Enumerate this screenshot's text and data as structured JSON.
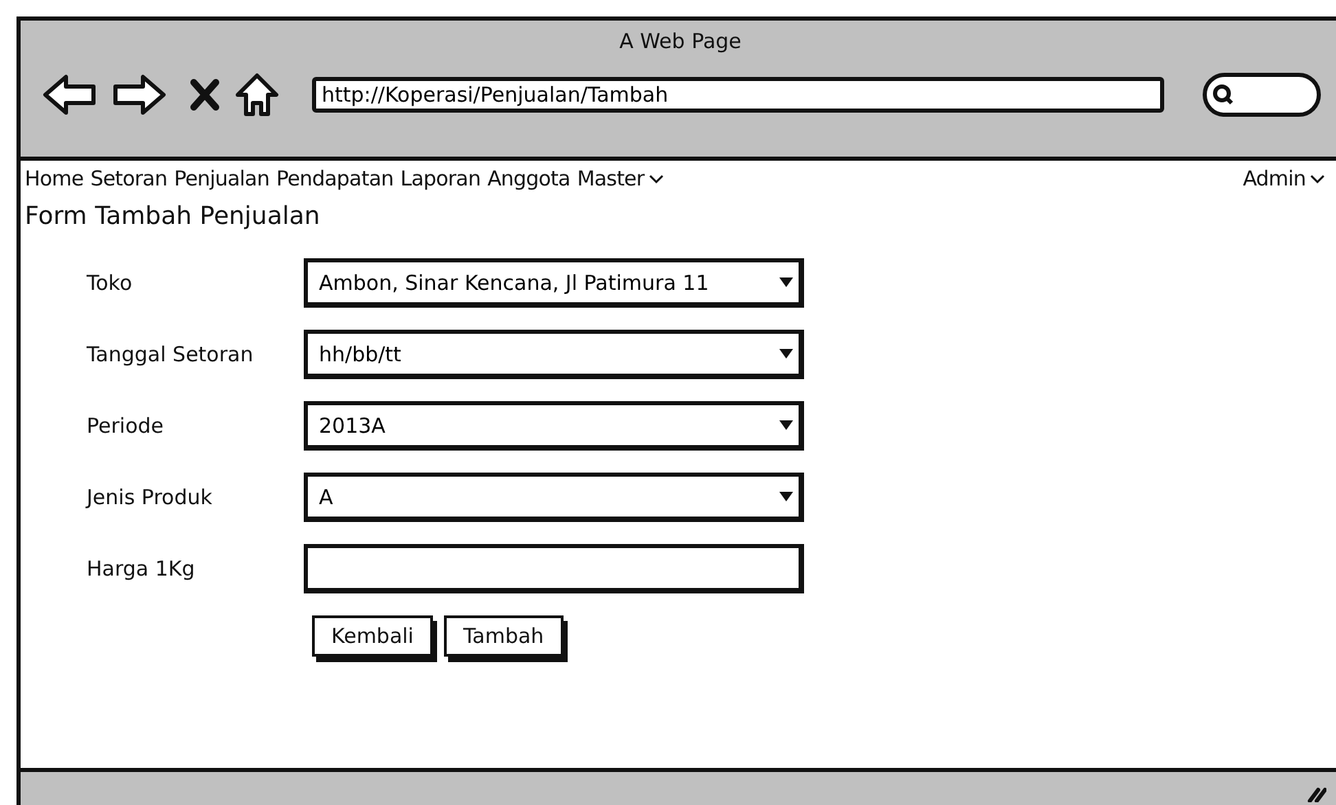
{
  "window": {
    "title": "A Web Page"
  },
  "address_bar": {
    "value": "http://Koperasi/Penjualan/Tambah"
  },
  "nav": {
    "items": [
      {
        "label": "Home",
        "dropdown": false
      },
      {
        "label": "Setoran",
        "dropdown": false
      },
      {
        "label": "Penjualan",
        "dropdown": false
      },
      {
        "label": "Pendapatan",
        "dropdown": false
      },
      {
        "label": "Laporan",
        "dropdown": false
      },
      {
        "label": "Anggota",
        "dropdown": false
      },
      {
        "label": "Master",
        "dropdown": true
      }
    ],
    "user": {
      "label": "Admin",
      "dropdown": true
    }
  },
  "form": {
    "title": "Form Tambah Penjualan",
    "fields": [
      {
        "label": "Toko",
        "kind": "select",
        "value": "Ambon, Sinar Kencana, Jl Patimura 11"
      },
      {
        "label": "Tanggal Setoran",
        "kind": "select",
        "value": "hh/bb/tt"
      },
      {
        "label": "Periode",
        "kind": "select",
        "value": "2013A"
      },
      {
        "label": "Jenis Produk",
        "kind": "select",
        "value": "A"
      },
      {
        "label": "Harga 1Kg",
        "kind": "text"
      }
    ],
    "buttons": [
      "Kembali",
      "Tambah"
    ]
  }
}
